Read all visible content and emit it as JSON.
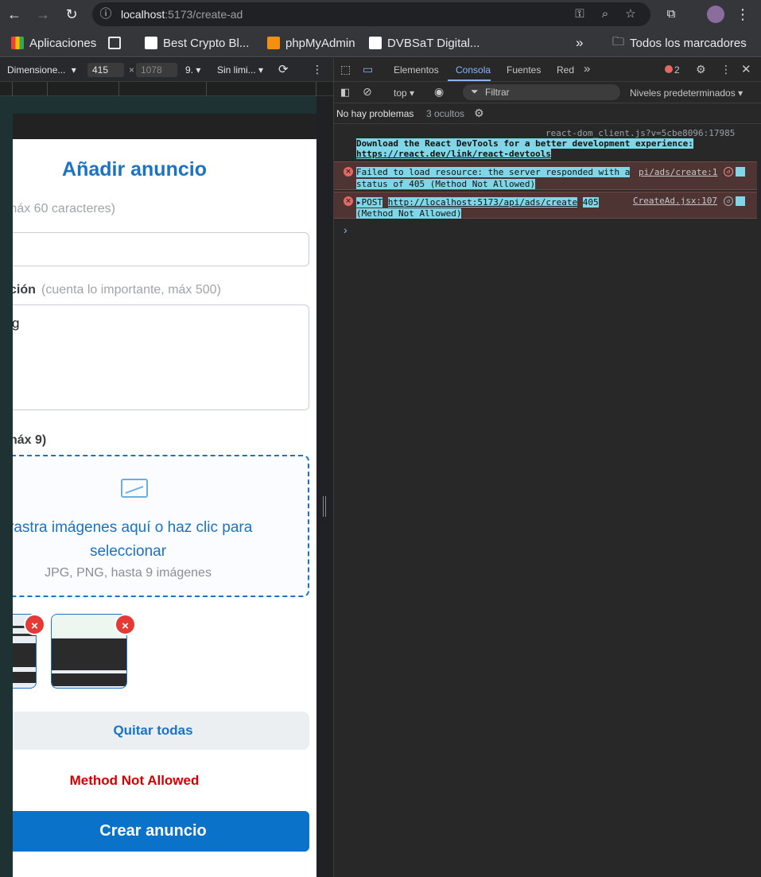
{
  "browser": {
    "url_host": "localhost",
    "url_path": ":5173/create-ad",
    "bookmarks": [
      {
        "label": "Aplicaciones",
        "color": "#4285f4"
      },
      {
        "label": "",
        "color": "#e8eaed"
      },
      {
        "label": "Best Crypto Bl...",
        "color": "#ffffff"
      },
      {
        "label": "phpMyAdmin",
        "color": "#f29111"
      },
      {
        "label": "DVBSaT Digital...",
        "color": "#111111"
      }
    ],
    "all_bookmarks_label": "Todos los marcadores",
    "overflow_label": "»"
  },
  "device_toolbar": {
    "device": "Dimensione...",
    "width": "415",
    "height": "1078",
    "zoom": "9.",
    "throttling": "Sin limi..."
  },
  "page": {
    "title": "Añadir anuncio",
    "title_hint": "máx 60 caracteres)",
    "desc_label": "ción",
    "desc_hint": "(cuenta lo importante, máx 500)",
    "desc_value": "g",
    "images_label": "náx 9)",
    "dropzone_text": "rrastra imágenes aquí o haz clic para seleccionar",
    "dropzone_sub": "JPG, PNG, hasta 9 imágenes",
    "remove_icon": "×",
    "remove_all": "Quitar todas",
    "error": "Method Not Allowed",
    "submit": "Crear anuncio"
  },
  "devtools": {
    "tabs": [
      "Elementos",
      "Consola",
      "Fuentes",
      "Red"
    ],
    "active_tab": "Consola",
    "error_count": "2",
    "context": "top",
    "filter_placeholder": "Filtrar",
    "levels": "Niveles predeterminados",
    "issues": "No hay problemas",
    "hidden": "3 ocultos",
    "messages": [
      {
        "source": "react-dom_client.js?v=5cbe8096:17985",
        "text_1": "Download the React DevTools for a better development experience:",
        "text_2": "https://react.dev/link/react-devtools"
      },
      {
        "source": "pi/ads/create:1",
        "text_1": "Failed to load resource: the server responded with a",
        "text_2": "status of 405 (Method Not Allowed)"
      },
      {
        "source": "CreateAd.jsx:107",
        "prefix": "POST",
        "url": "http://localhost:5173/api/ads/create",
        "status": "405",
        "text_2": "(Method Not Allowed)"
      }
    ],
    "prompt": "›"
  }
}
